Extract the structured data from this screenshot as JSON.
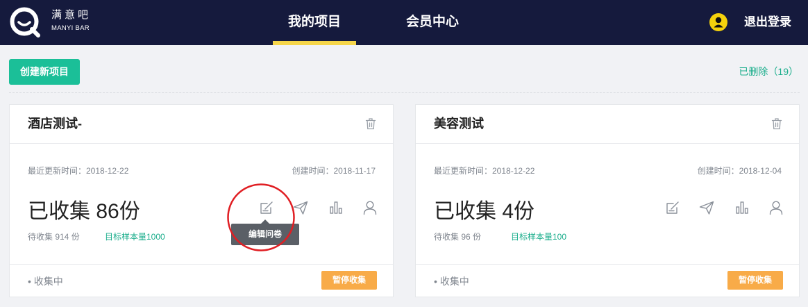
{
  "header": {
    "logo": {
      "name": "满意吧",
      "sub": "MANYI BAR"
    },
    "nav": [
      {
        "label": "我的项目",
        "active": true
      },
      {
        "label": "会员中心",
        "active": false
      }
    ],
    "logout_label": "退出登录"
  },
  "toolbar": {
    "create_label": "创建新项目",
    "deleted_label": "已删除（19）"
  },
  "projects": [
    {
      "title": "酒店测试-",
      "updated": "最近更新时间：2018-12-22",
      "created": "创建时间：2018-11-17",
      "collected": "已收集 86份",
      "pending": "待收集 914 份",
      "target": "目标样本量1000",
      "status": "• 收集中",
      "action_label": "暂停收集"
    },
    {
      "title": "美容测试",
      "updated": "最近更新时间：2018-12-22",
      "created": "创建时间：2018-12-04",
      "collected": "已收集 4份",
      "pending": "待收集 96 份",
      "target": "目标样本量100",
      "status": "• 收集中",
      "action_label": "暂停收集"
    }
  ],
  "tooltip": {
    "label": "编辑问卷"
  },
  "icons": {
    "logo": "logo-icon",
    "account": "avatar-icon",
    "card_delete": "trash-icon",
    "card_actions": [
      "edit-icon",
      "send-icon",
      "bar-chart-icon",
      "user-icon"
    ]
  },
  "colors": {
    "nav": "#151a3d",
    "accent": "#f6d64a",
    "page_bg": "#f1f2f5",
    "primary": "#1bbf98",
    "primary_text": "#19ad8b",
    "warning": "#f8ab48",
    "tooltip": "#5a5f66",
    "annotation": "#e01e23",
    "avatar": "#f5d20c"
  }
}
